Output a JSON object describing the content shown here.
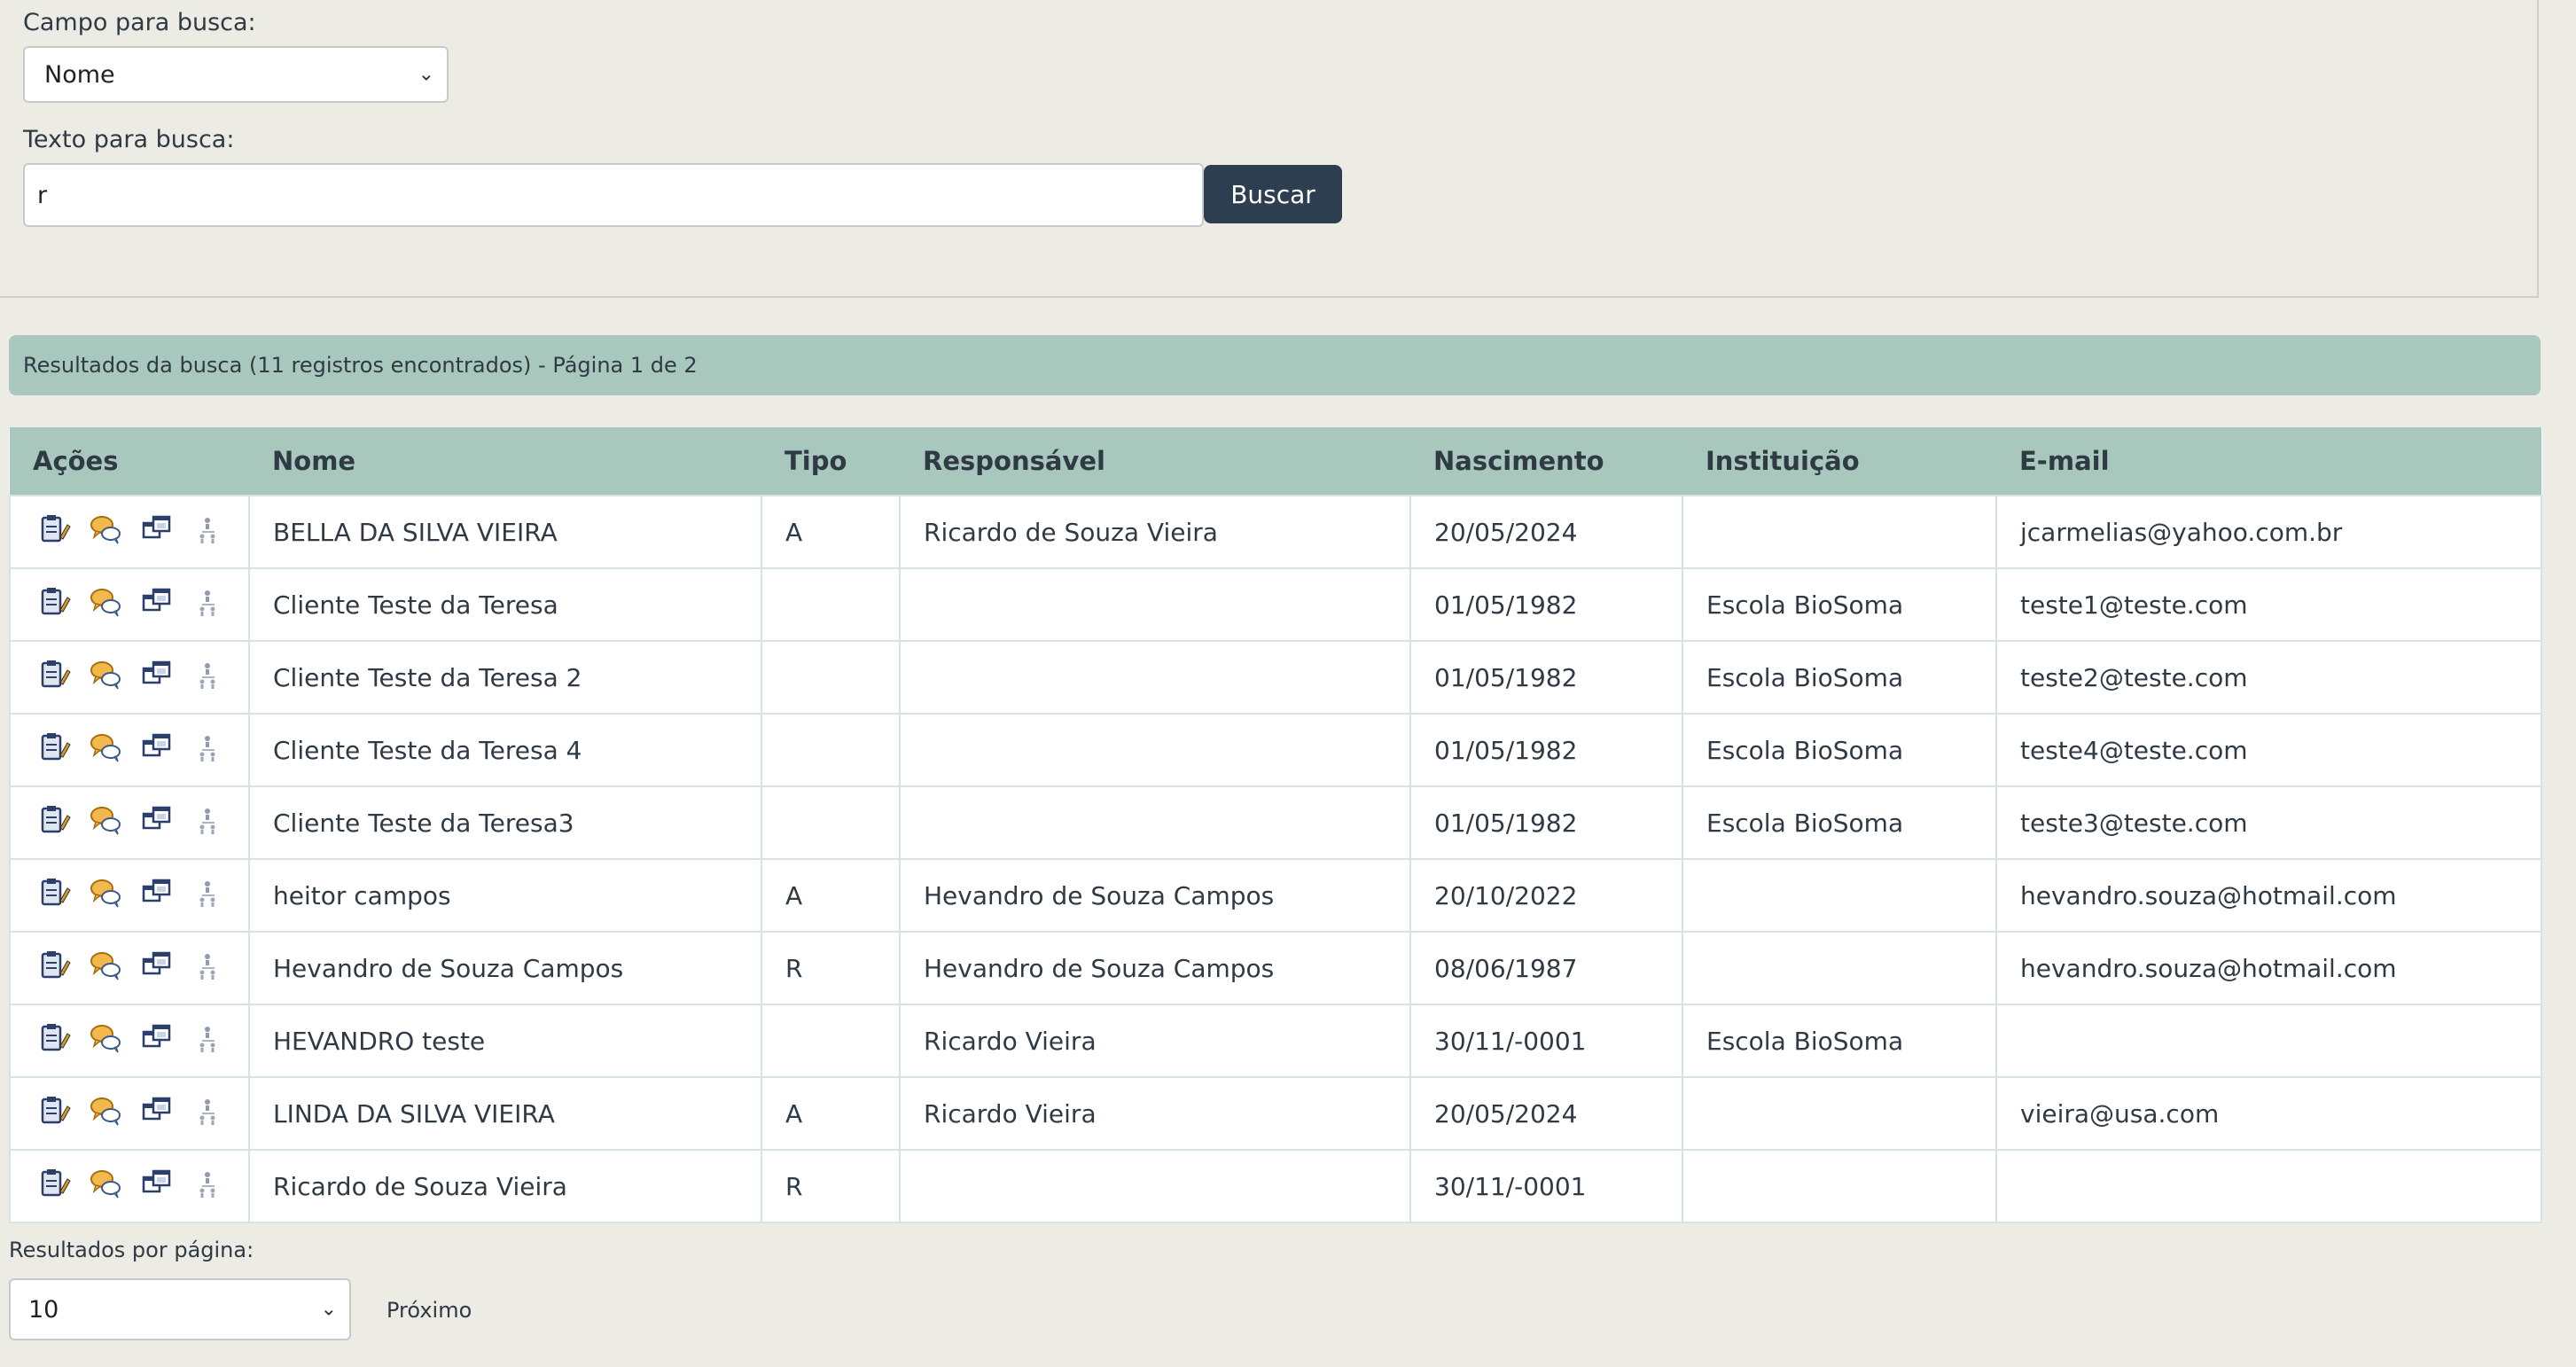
{
  "search": {
    "field_label": "Campo para busca:",
    "field_value": "Nome",
    "text_label": "Texto para busca:",
    "text_value": "r",
    "button_label": "Buscar"
  },
  "results": {
    "summary": "Resultados da busca (11 registros encontrados) - Página 1 de 2"
  },
  "table": {
    "headers": [
      "Ações",
      "Nome",
      "Tipo",
      "Responsável",
      "Nascimento",
      "Instituição",
      "E-mail"
    ],
    "rows": [
      {
        "nome": "BELLA DA SILVA VIEIRA",
        "tipo": "A",
        "responsavel": "Ricardo de Souza Vieira",
        "nascimento": "20/05/2024",
        "instituicao": "",
        "email": "jcarmelias@yahoo.com.br"
      },
      {
        "nome": "Cliente Teste da Teresa",
        "tipo": "",
        "responsavel": "",
        "nascimento": "01/05/1982",
        "instituicao": "Escola BioSoma",
        "email": "teste1@teste.com"
      },
      {
        "nome": "Cliente Teste da Teresa 2",
        "tipo": "",
        "responsavel": "",
        "nascimento": "01/05/1982",
        "instituicao": "Escola BioSoma",
        "email": "teste2@teste.com"
      },
      {
        "nome": "Cliente Teste da Teresa 4",
        "tipo": "",
        "responsavel": "",
        "nascimento": "01/05/1982",
        "instituicao": "Escola BioSoma",
        "email": "teste4@teste.com"
      },
      {
        "nome": "Cliente Teste da Teresa3",
        "tipo": "",
        "responsavel": "",
        "nascimento": "01/05/1982",
        "instituicao": "Escola BioSoma",
        "email": "teste3@teste.com"
      },
      {
        "nome": "heitor campos",
        "tipo": "A",
        "responsavel": "Hevandro de Souza Campos",
        "nascimento": "20/10/2022",
        "instituicao": "",
        "email": "hevandro.souza@hotmail.com"
      },
      {
        "nome": "Hevandro de Souza Campos",
        "tipo": "R",
        "responsavel": "Hevandro de Souza Campos",
        "nascimento": "08/06/1987",
        "instituicao": "",
        "email": "hevandro.souza@hotmail.com"
      },
      {
        "nome": "HEVANDRO teste",
        "tipo": "",
        "responsavel": "Ricardo Vieira",
        "nascimento": "30/11/-0001",
        "instituicao": "Escola BioSoma",
        "email": ""
      },
      {
        "nome": "LINDA DA SILVA VIEIRA",
        "tipo": "A",
        "responsavel": "Ricardo Vieira",
        "nascimento": "20/05/2024",
        "instituicao": "",
        "email": "vieira@usa.com"
      },
      {
        "nome": "Ricardo de Souza Vieira",
        "tipo": "R",
        "responsavel": "",
        "nascimento": "30/11/-0001",
        "instituicao": "",
        "email": ""
      }
    ],
    "row_action_icons": [
      "clipboard-edit-icon",
      "chat-bubbles-icon",
      "windows-icon",
      "user-tree-icon"
    ]
  },
  "pagination": {
    "per_page_label": "Resultados por página:",
    "per_page_value": "10",
    "next_label": "Próximo"
  },
  "colors": {
    "background": "#ecebe4",
    "header_bg": "#a9c8bd",
    "button_bg": "#2d3e50"
  }
}
